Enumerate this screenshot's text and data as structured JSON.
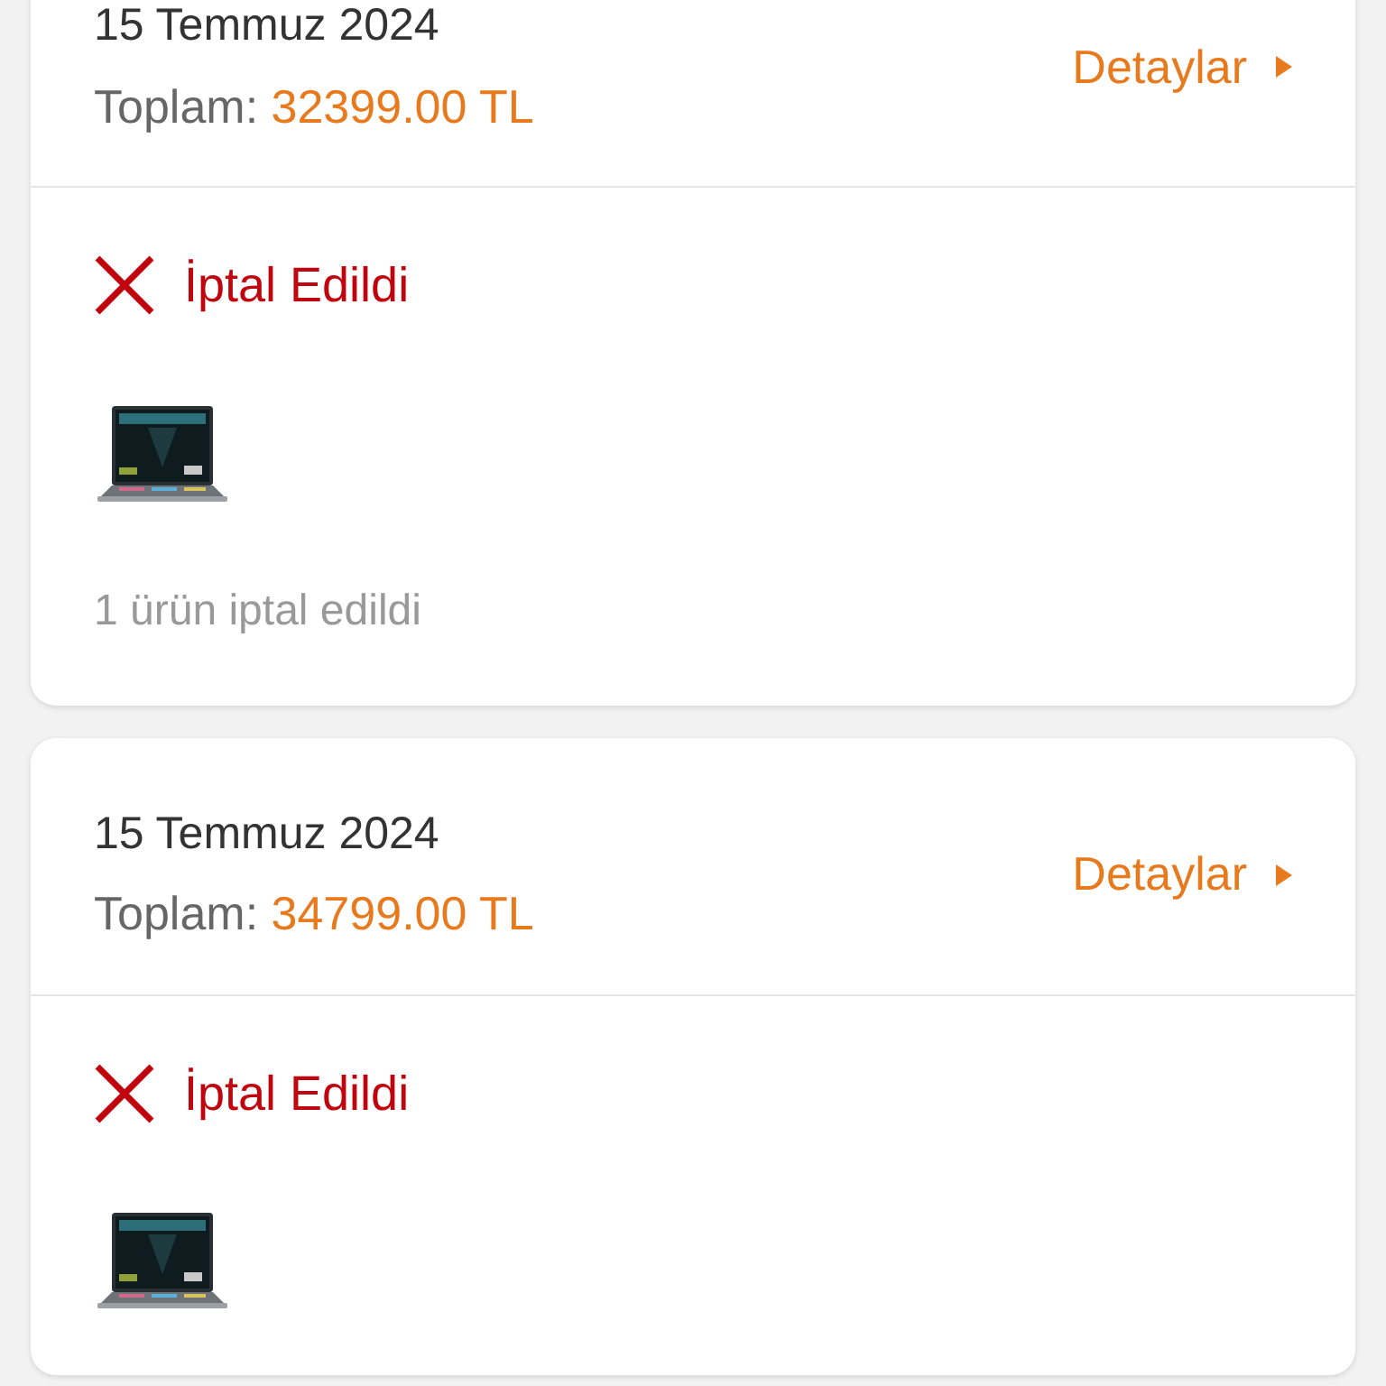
{
  "orders": [
    {
      "date": "15 Temmuz 2024",
      "total_label": "Toplam:",
      "total": "32399.00 TL",
      "details": "Detaylar",
      "status": {
        "kind": "cancelled",
        "label": "İptal Edildi"
      },
      "note": "1 ürün iptal edildi"
    },
    {
      "date": "15 Temmuz 2024",
      "total_label": "Toplam:",
      "total": "34799.00 TL",
      "details": "Detaylar",
      "status": {
        "kind": "cancelled",
        "label": "İptal Edildi"
      }
    }
  ]
}
